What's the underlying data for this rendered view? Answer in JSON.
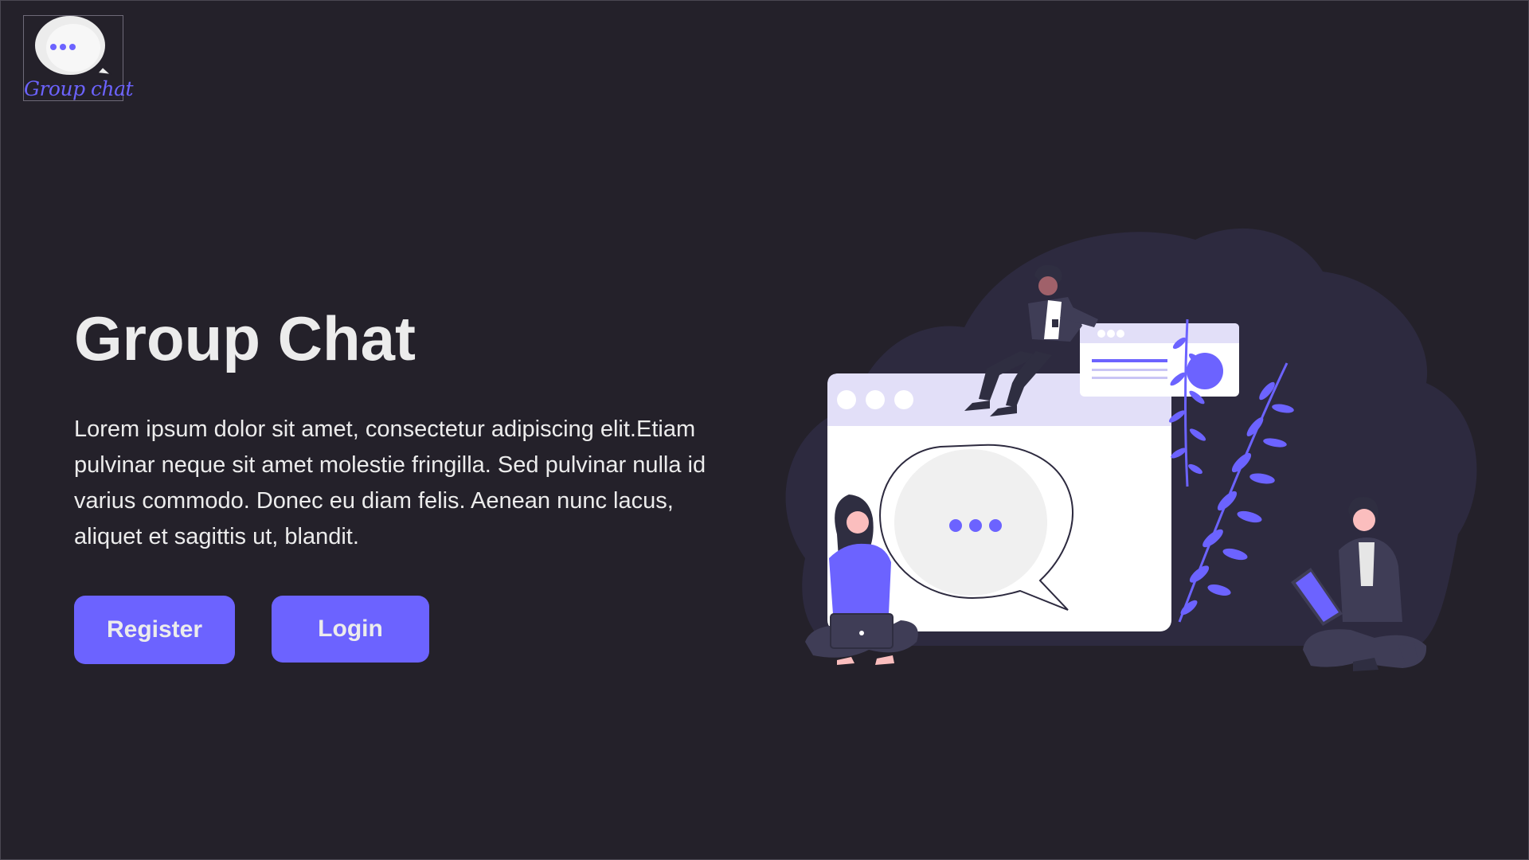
{
  "brand": {
    "logo_text": "Group chat",
    "logo_icon": "chat-bubble-icon",
    "accent_color": "#6c63ff"
  },
  "hero": {
    "title": "Group Chat",
    "description": "Lorem ipsum dolor sit amet, consectetur adipiscing elit.Etiam pulvinar neque sit amet molestie fringilla. Sed pulvinar nulla id varius commodo. Donec eu diam felis. Aenean nunc lacus, aliquet et sagittis ut, blandit."
  },
  "actions": {
    "register_label": "Register",
    "login_label": "Login"
  },
  "illustration": {
    "icon": "group-chat-illustration"
  },
  "colors": {
    "background": "#24212a",
    "text": "#ececec",
    "button": "#6c63ff"
  }
}
